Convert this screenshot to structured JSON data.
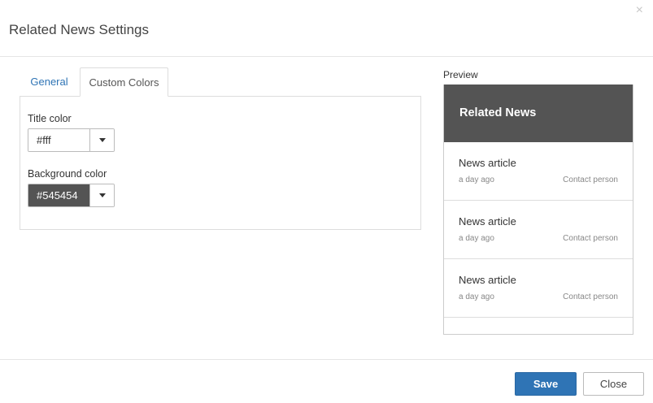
{
  "dialog": {
    "title": "Related News Settings",
    "close_glyph": "×"
  },
  "tabs": [
    {
      "label": "General",
      "active": false
    },
    {
      "label": "Custom Colors",
      "active": true
    }
  ],
  "fields": {
    "title_color": {
      "label": "Title color",
      "value": "#fff"
    },
    "background_color": {
      "label": "Background color",
      "value": "#545454"
    }
  },
  "preview": {
    "label": "Preview",
    "header_title": "Related News",
    "items": [
      {
        "title": "News article",
        "time": "a day ago",
        "person": "Contact person"
      },
      {
        "title": "News article",
        "time": "a day ago",
        "person": "Contact person"
      },
      {
        "title": "News article",
        "time": "a day ago",
        "person": "Contact person"
      }
    ]
  },
  "footer": {
    "save_label": "Save",
    "close_label": "Close"
  },
  "colors": {
    "accent": "#2f74b5",
    "preview_header_bg": "#545454",
    "preview_header_text": "#ffffff"
  },
  "icons": {
    "close": "close-icon",
    "dropdown": "caret-down-icon"
  }
}
